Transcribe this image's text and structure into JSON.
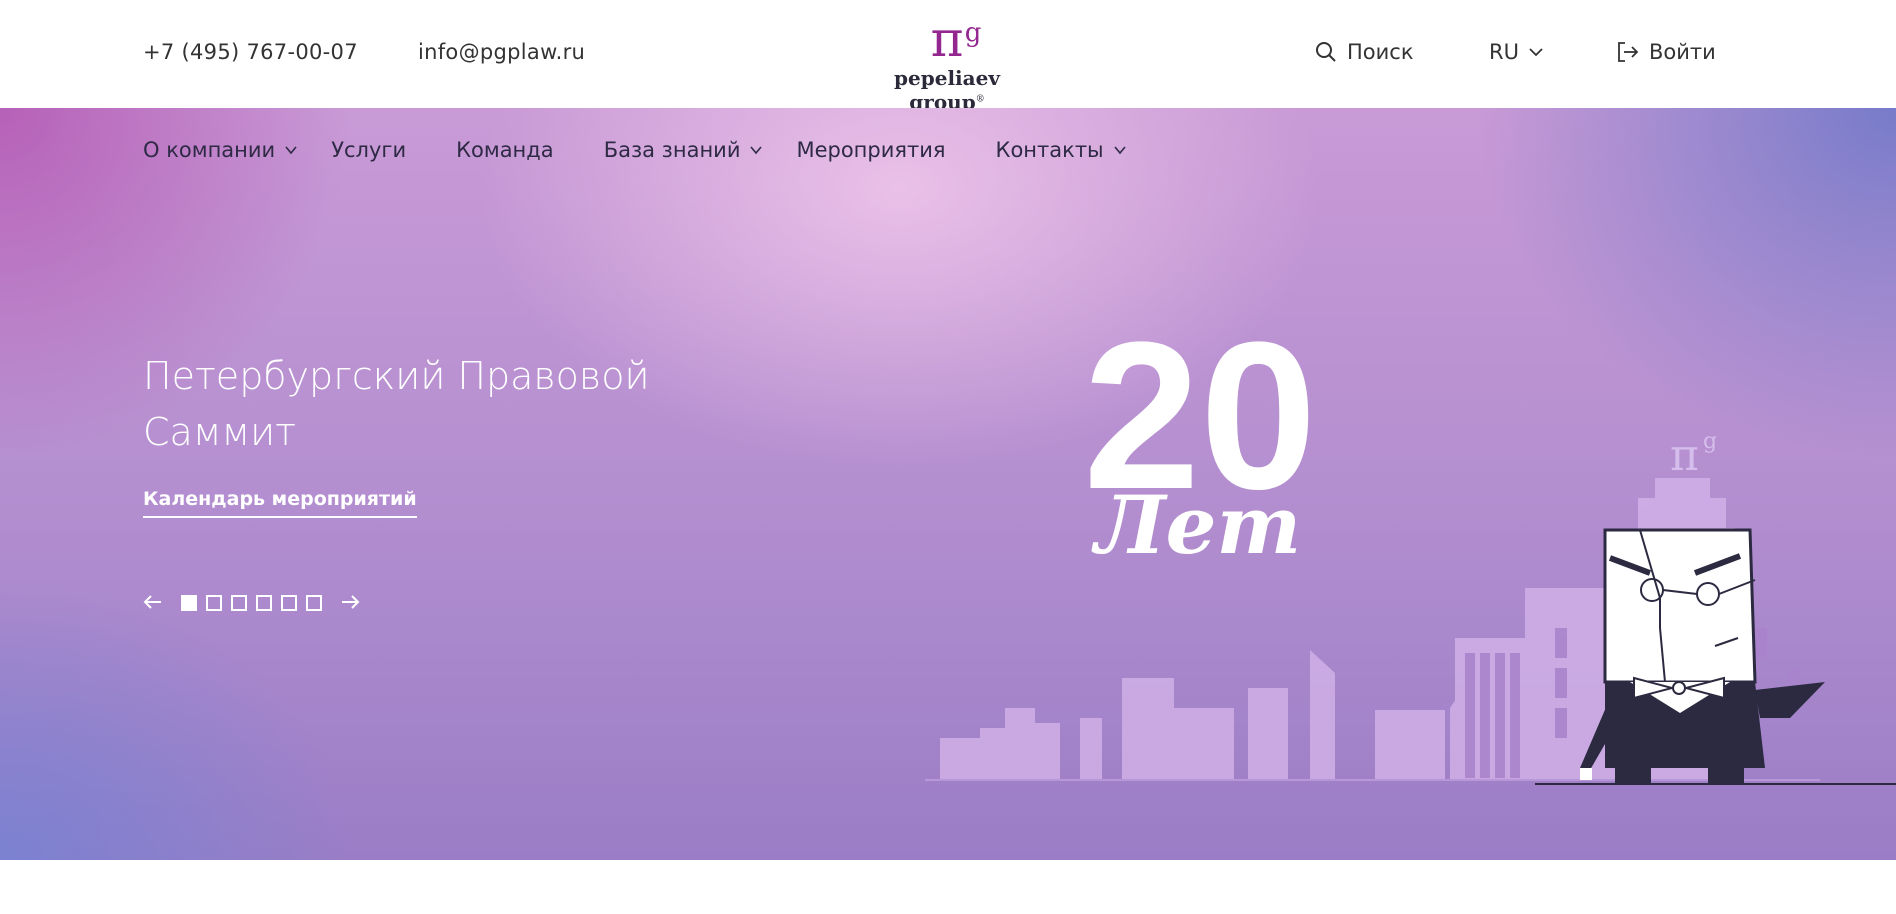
{
  "header": {
    "phone": "+7 (495) 767-00-07",
    "email": "info@pgplaw.ru",
    "logo": {
      "symbol": "π",
      "superscript": "g",
      "name": "pepeliaev group",
      "reg": "®"
    },
    "search_label": "Поиск",
    "language": "RU",
    "login_label": "Войти"
  },
  "nav": {
    "items": [
      {
        "label": "О компании",
        "has_dropdown": true
      },
      {
        "label": "Услуги",
        "has_dropdown": false
      },
      {
        "label": "Команда",
        "has_dropdown": false
      },
      {
        "label": "База знаний",
        "has_dropdown": true
      },
      {
        "label": "Мероприятия",
        "has_dropdown": false
      },
      {
        "label": "Контакты",
        "has_dropdown": true
      }
    ]
  },
  "hero": {
    "title_line1": "Петербургский Правовой",
    "title_line2": "Саммит",
    "link_label": "Календарь мероприятий",
    "slider": {
      "total": 6,
      "active": 1
    },
    "anniversary_number": "20",
    "anniversary_word": "Лет"
  },
  "colors": {
    "brand": "#93278f",
    "text_dark": "#2a2a3a",
    "building": "#c9a6e0",
    "character_dark": "#2b2a40"
  },
  "icons": [
    "search-icon",
    "chevron-down-icon",
    "login-icon",
    "arrow-left-icon",
    "arrow-right-icon"
  ]
}
